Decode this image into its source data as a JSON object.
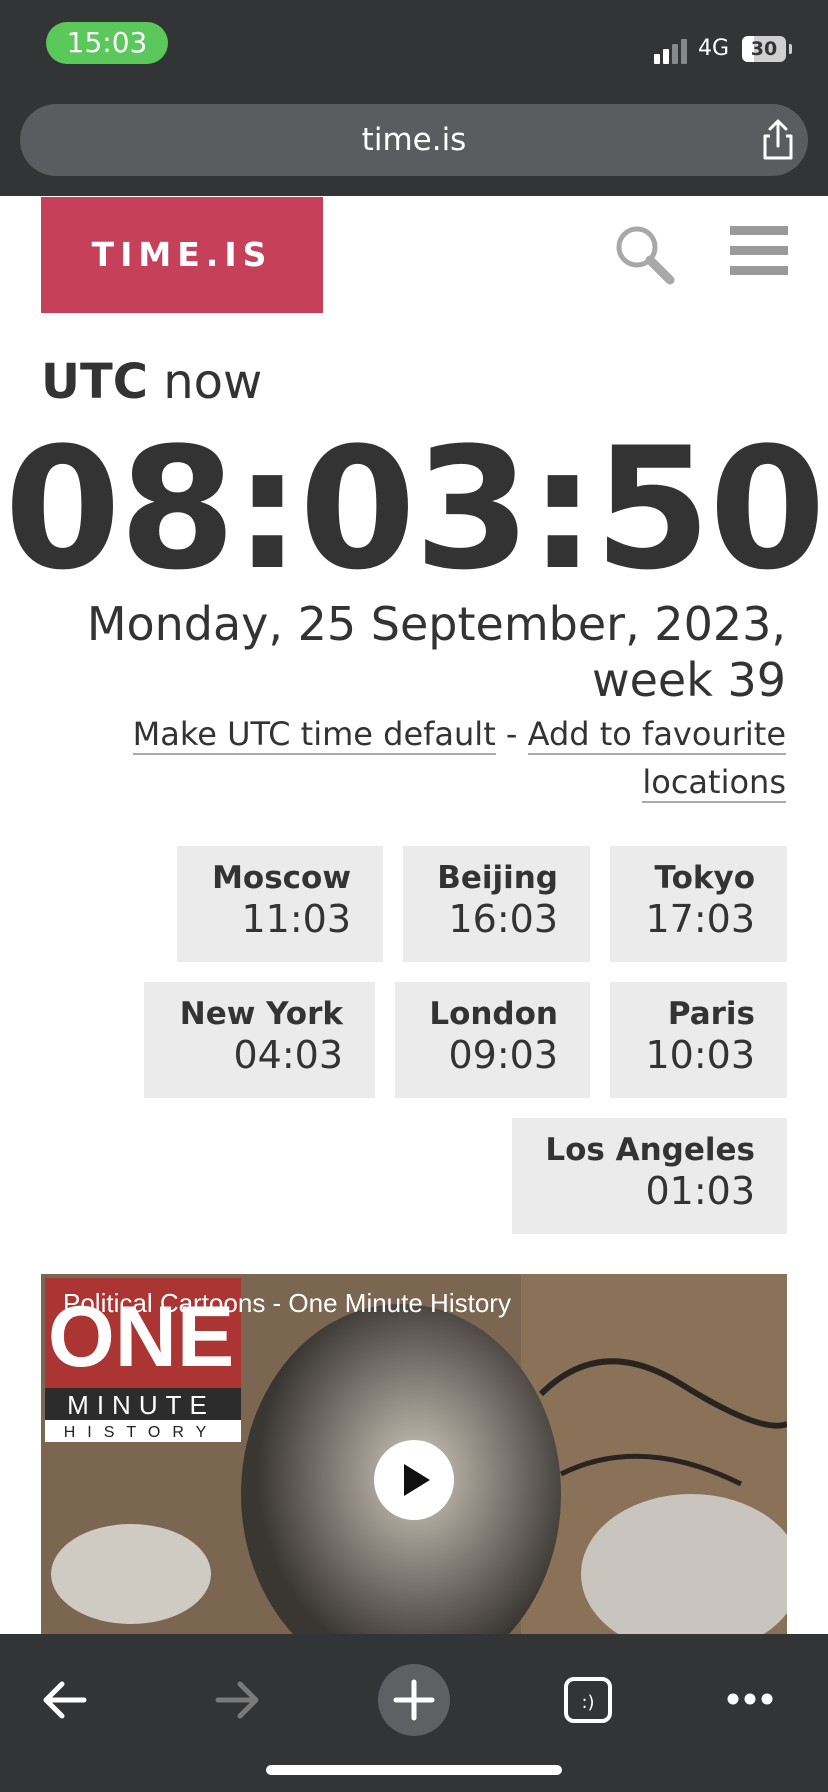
{
  "status": {
    "time": "15:03",
    "network": "4G",
    "battery": "30"
  },
  "browser": {
    "url": "time.is"
  },
  "site": {
    "logo": "TIME.IS"
  },
  "heading": {
    "tz": "UTC",
    "suffix": " now"
  },
  "clock": {
    "time": "08:03:50"
  },
  "date": {
    "line1": "Monday, 25 September, 2023,",
    "line2": "week 39"
  },
  "links": {
    "make_default": "Make UTC time default",
    "separator": " - ",
    "add_favourite_1": "Add to favourite",
    "add_favourite_2": "locations"
  },
  "cities": [
    {
      "name": "Moscow",
      "time": "11:03"
    },
    {
      "name": "Beijing",
      "time": "16:03"
    },
    {
      "name": "Tokyo",
      "time": "17:03"
    },
    {
      "name": "New York",
      "time": "04:03"
    },
    {
      "name": "London",
      "time": "09:03"
    },
    {
      "name": "Paris",
      "time": "10:03"
    },
    {
      "name": "Los Angeles",
      "time": "01:03"
    }
  ],
  "video": {
    "title": "Political Cartoons - One Minute History",
    "logo_big": "ONE",
    "logo_mid": "MINUTE",
    "logo_small": "HISTORY"
  },
  "colors": {
    "brand": "#c6405a",
    "status_pill": "#5ac85a",
    "chrome": "#333436"
  },
  "icons": [
    "share-icon",
    "search-icon",
    "menu-icon",
    "play-icon",
    "back-icon",
    "forward-icon",
    "new-tab-icon",
    "tabs-icon",
    "more-icon"
  ]
}
